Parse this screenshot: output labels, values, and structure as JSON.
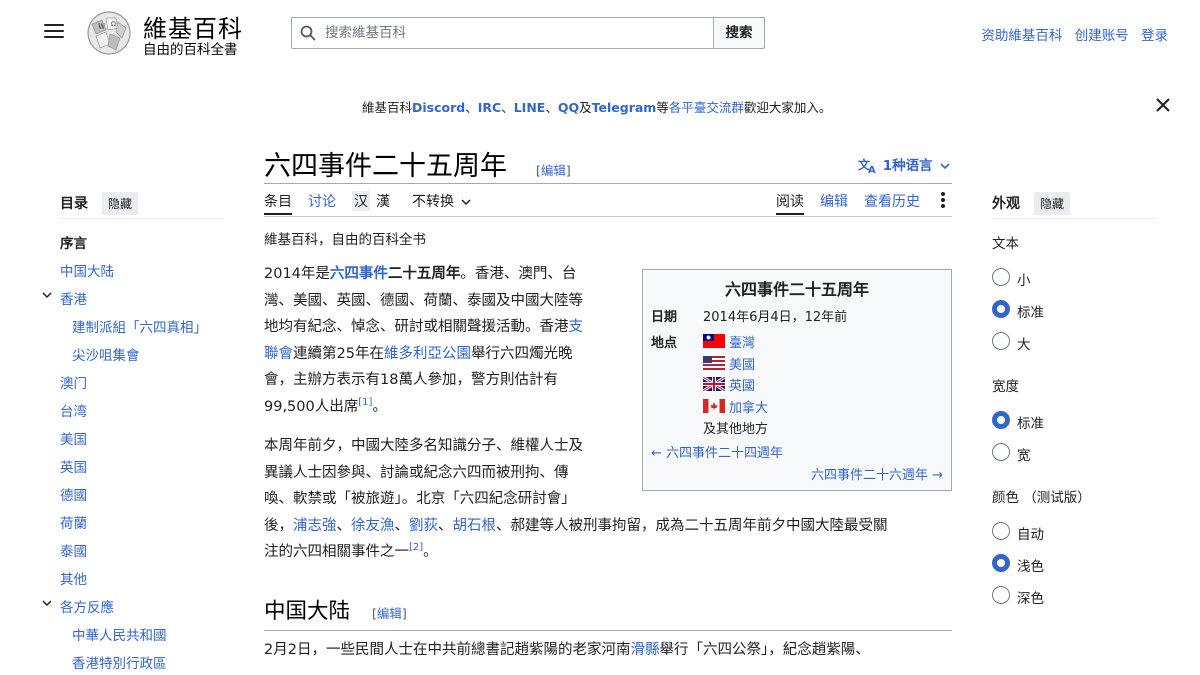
{
  "header": {
    "logo_title": "維基百科",
    "logo_subtitle": "自由的百科全書",
    "search_placeholder": "搜索維基百科",
    "search_button": "搜索",
    "links": [
      "资助維基百科",
      "创建账号",
      "登录"
    ]
  },
  "notice": {
    "prefix": "維基百科",
    "items": [
      "Discord",
      "IRC",
      "LINE",
      "QQ",
      "Telegram"
    ],
    "sep": "、",
    "and": "及",
    "mid": "等",
    "link": "各平臺交流群",
    "suffix": "歡迎大家加入。"
  },
  "article": {
    "title": "六四事件二十五周年",
    "edit_open": "[",
    "edit": "编辑",
    "edit_close": "]",
    "languages": "1种语言",
    "tabs_left": [
      "条目",
      "讨论",
      "汉",
      "漢",
      "不转换"
    ],
    "tabs_right": [
      "阅读",
      "编辑",
      "查看历史"
    ],
    "tagline": "維基百科，自由的百科全书",
    "p1": {
      "year": "2014年是",
      "link1": "六四事件",
      "bold": "二十五周年",
      "t1": "。香港、澳門、台",
      "l2": "灣、美國、英國、德國、荷蘭、泰國及中國大陸等",
      "l3a": "地均有紀念、悼念、研討或相關聲援活動。香港",
      "l3link": "支",
      "l4link": "聯會",
      "l4a": "連續第25年在",
      "l4link2": "維多利亞公園",
      "l4b": "舉行六四燭光晚",
      "l5": "會，主辦方表示有18萬人參加，警方則估計有",
      "l6": "99,500人出席",
      "ref": "[1]",
      "end": "。"
    },
    "p2": {
      "l1": "本周年前夕，中國大陸多名知識分子、維權人士及",
      "l2": "異議人士因參與、討論或紀念六四而被刑拘、傳",
      "l3": "喚、軟禁或「被旅遊」。北京「六四紀念研討會」",
      "l4a": "後，",
      "names": [
        "浦志強",
        "徐友漁",
        "劉荻",
        "胡石根"
      ],
      "sep": "、",
      "l4b": "、郝建等人被刑事拘留，成為二十五周年前夕中國大陸最受關",
      "l5": "注的六四相關事件之一",
      "ref": "[2]",
      "end": "。"
    },
    "section1": "中国大陆",
    "p3": {
      "l1a": "2月2日，一些民間人士在中共前總書記趙紫陽的老家河南",
      "l1link": "滑縣",
      "l1b": "舉行「六四公祭」，紀念趙紫陽、"
    }
  },
  "infobox": {
    "title": "六四事件二十五周年",
    "date_label": "日期",
    "date_value": "2014年6月4日，12年前",
    "place_label": "地点",
    "places": [
      "臺灣",
      "美國",
      "英國",
      "加拿大"
    ],
    "other": "及其他地方",
    "prev": "← 六四事件二十四週年",
    "next": "六四事件二十六週年 →"
  },
  "toc": {
    "title": "目录",
    "hide": "隐藏",
    "items": [
      "序言",
      "中国大陆",
      "香港",
      "建制派組「六四真相」",
      "尖沙咀集會",
      "澳门",
      "台湾",
      "美国",
      "英国",
      "德國",
      "荷蘭",
      "泰國",
      "其他",
      "各方反應",
      "中華人民共和國",
      "香港特別行政區"
    ]
  },
  "appearance": {
    "title": "外观",
    "hide": "隐藏",
    "text_label": "文本",
    "text_options": [
      "小",
      "标准",
      "大"
    ],
    "width_label": "宽度",
    "width_options": [
      "标准",
      "宽"
    ],
    "color_label": "颜色 （测试版）",
    "color_options": [
      "自动",
      "浅色",
      "深色"
    ],
    "accent": "#3366cc"
  }
}
